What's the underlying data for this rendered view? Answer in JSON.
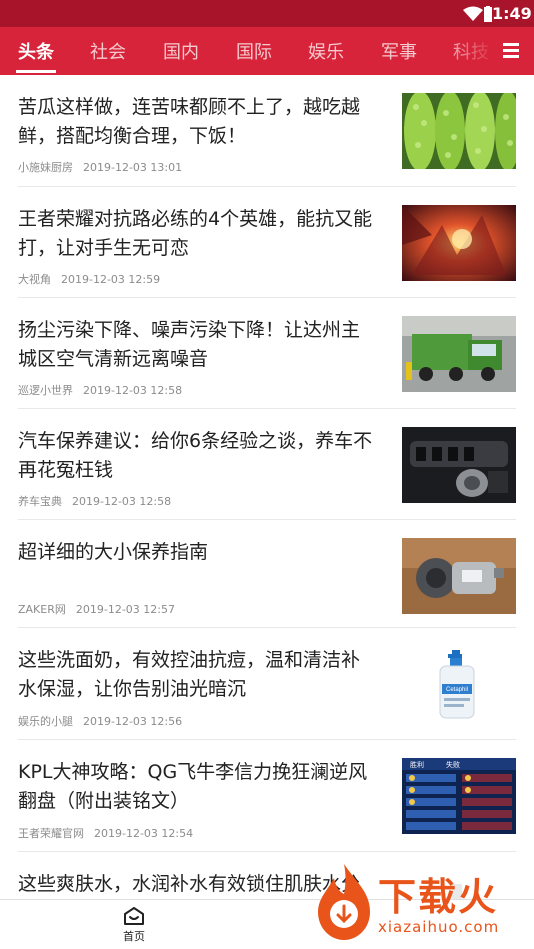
{
  "status_bar": {
    "time": "1:49"
  },
  "tabs": [
    {
      "label": "头条",
      "active": true
    },
    {
      "label": "社会"
    },
    {
      "label": "国内"
    },
    {
      "label": "国际"
    },
    {
      "label": "娱乐"
    },
    {
      "label": "军事"
    },
    {
      "label": "科技"
    }
  ],
  "articles": [
    {
      "title": "苦瓜这样做，连苦味都顾不上了，越吃越鲜，搭配均衡合理，下饭！",
      "source": "小施妹厨房",
      "date": "2019-12-03 13:01",
      "image": "bitter-melon-photo"
    },
    {
      "title": "王者荣耀对抗路必练的4个英雄，能抗又能打，让对手生无可恋",
      "source": "大视角",
      "date": "2019-12-03 12:59",
      "image": "game-hero-art"
    },
    {
      "title": "扬尘污染下降、噪声污染下降！让达州主城区空气清新远离噪音",
      "source": "巡逻小世界",
      "date": "2019-12-03 12:58",
      "image": "green-trucks-photo"
    },
    {
      "title": "汽车保养建议：给你6条经验之谈，养车不再花冤枉钱",
      "source": "养车宝典",
      "date": "2019-12-03 12:58",
      "image": "car-dashboard-photo"
    },
    {
      "title": "超详细的大小保养指南",
      "source": "ZAKER网",
      "date": "2019-12-03 12:57",
      "image": "ac-compressor-photo"
    },
    {
      "title": "这些洗面奶，有效控油抗痘，温和清洁补水保湿，让你告别油光暗沉",
      "source": "娱乐的小腿",
      "date": "2019-12-03 12:56",
      "image": "cetaphil-bottle-photo",
      "brand": "Cetaphil"
    },
    {
      "title": "KPL大神攻略：QG飞牛李信力挽狂澜逆风翻盘（附出装铭文）",
      "source": "王者荣耀官网",
      "date": "2019-12-03 12:54",
      "image": "game-scoreboard-screenshot",
      "overlay_labels": [
        "胜利",
        "失败"
      ]
    },
    {
      "title": "这些爽肤水，水润补水有效锁住肌肤水分",
      "source": "",
      "date": "",
      "image": "skincare-photo"
    }
  ],
  "bottom_nav": {
    "home_label": "首页"
  },
  "watermark": {
    "text": "下载火",
    "url": "xiazaihuo.com"
  }
}
